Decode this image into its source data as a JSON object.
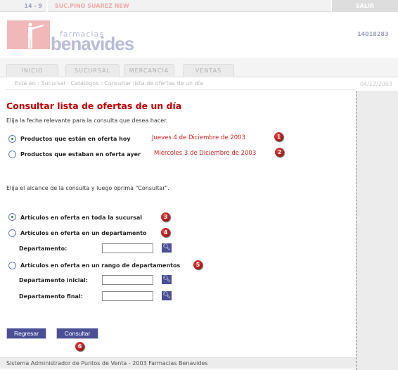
{
  "header": {
    "branch_code": "14 - 9",
    "branch_name": "SUC.PINO SUAREZ NEW",
    "logout": "SALIR",
    "user_id": "14018283",
    "logo_text_small": "farmacias",
    "logo_text_big": "benavides"
  },
  "tabs": [
    {
      "label": "INICIO"
    },
    {
      "label": "SUCURSAL"
    },
    {
      "label": "MERCANCÍA"
    },
    {
      "label": "VENTAS"
    }
  ],
  "breadcrumb": "Está en : Sucursal : Catálogos : Consultar lista de ofertas de un día",
  "date": "04/12/2003",
  "main": {
    "title": "Consultar lista de ofertas de un día",
    "instruction1": "Elija la fecha relevante para la consulta que desea hacer.",
    "date_options": [
      {
        "label": "Productos que están en oferta hoy",
        "date": "Jueves 4 de Diciembre de 2003",
        "badge": "1",
        "selected": true
      },
      {
        "label": "Productos que estaban en oferta ayer",
        "date": "Miercoles 3 de Diciembre de 2003",
        "badge": "2",
        "selected": false
      }
    ],
    "instruction2": "Elija el alcance de la consulta y luego oprima \"Consultar\".",
    "scope_options": [
      {
        "label": "Artículos en oferta en toda la sucursal",
        "badge": "3",
        "selected": true
      },
      {
        "label": "Artículos en oferta en un departamento",
        "badge": "4",
        "selected": false
      },
      {
        "label": "Artículos en oferta en un rango de departamentos",
        "badge": "5",
        "selected": false
      }
    ],
    "fields": {
      "departamento": {
        "label": "Departamento:",
        "value": ""
      },
      "inicial": {
        "label": "Departamento inicial:",
        "value": ""
      },
      "final": {
        "label": "Departamento final:",
        "value": ""
      }
    },
    "buttons": {
      "back": "Regresar",
      "submit": "Consultar",
      "submit_badge": "6"
    }
  },
  "footer": "Sistema Administrador de Puntos de Venta - 2003 Farmacias Benavides",
  "colors": {
    "title": "#c00000",
    "button": "#4a4f96",
    "logo_pink": "#f0b8b8",
    "logo_blue": "#b8bcd8"
  }
}
